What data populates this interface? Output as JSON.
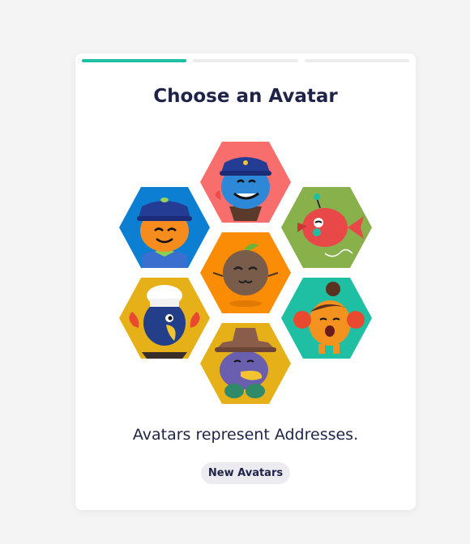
{
  "progress": {
    "total_steps": 3,
    "current_step": 1,
    "active_color": "#1fbfa3",
    "inactive_color": "#ececec"
  },
  "title": "Choose an Avatar",
  "avatars": [
    {
      "name": "police-whale-avatar",
      "color": "#f86e6c"
    },
    {
      "name": "police-pumpkin-avatar",
      "color": "#0d7fd3"
    },
    {
      "name": "fish-avatar",
      "color": "#88b04b"
    },
    {
      "name": "coconut-avatar",
      "color": "#fb8c05"
    },
    {
      "name": "chef-bird-avatar",
      "color": "#e6b019"
    },
    {
      "name": "crab-girl-avatar",
      "color": "#1fbfa3"
    },
    {
      "name": "cowboy-platypus-avatar",
      "color": "#e6b019"
    }
  ],
  "caption": "Avatars represent Addresses.",
  "new_button_label": "New Avatars"
}
